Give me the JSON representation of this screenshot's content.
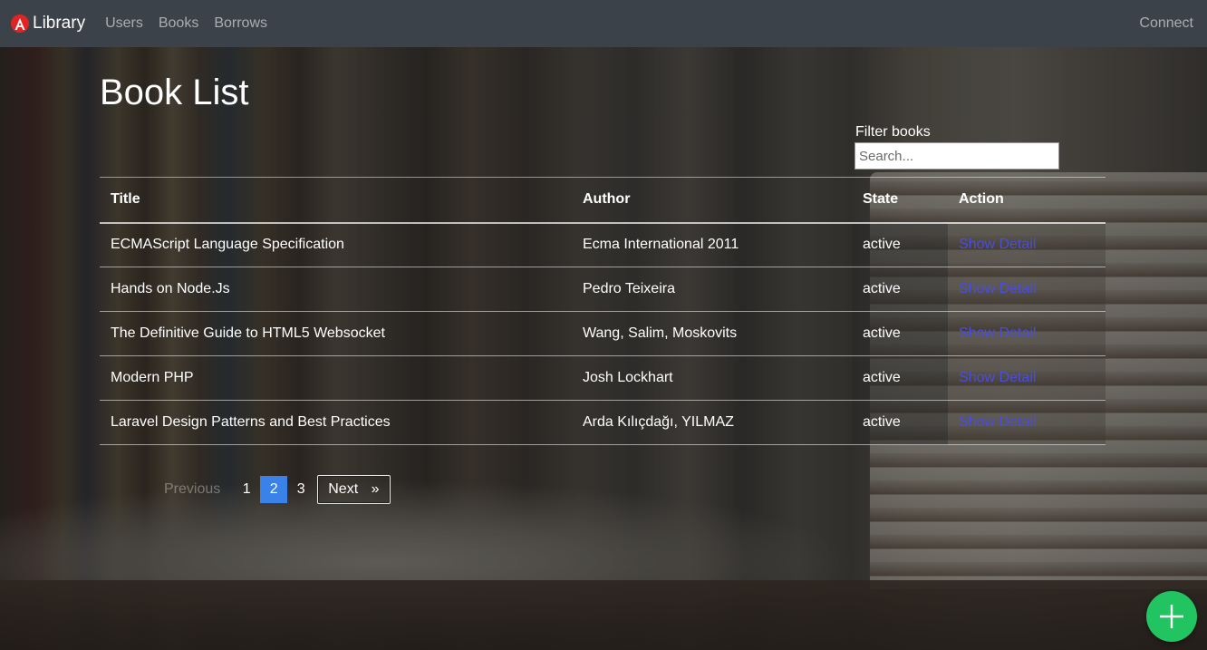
{
  "navbar": {
    "brand": "Library",
    "brand_icon": "angular-logo-icon",
    "links": [
      "Users",
      "Books",
      "Borrows"
    ],
    "connect": "Connect"
  },
  "page": {
    "title": "Book List"
  },
  "filter": {
    "label": "Filter books",
    "placeholder": "Search...",
    "value": ""
  },
  "table": {
    "headers": [
      "Title",
      "Author",
      "State",
      "Action"
    ],
    "rows": [
      {
        "title": "ECMAScript Language Specification",
        "author": "Ecma International 2011",
        "state": "active",
        "action": "Show Detail"
      },
      {
        "title": "Hands on Node.Js",
        "author": "Pedro Teixeira",
        "state": "active",
        "action": "Show Detail"
      },
      {
        "title": "The Definitive Guide to HTML5 Websocket",
        "author": "Wang, Salim, Moskovits",
        "state": "active",
        "action": "Show Detail"
      },
      {
        "title": "Modern PHP",
        "author": "Josh Lockhart",
        "state": "active",
        "action": "Show Detail"
      },
      {
        "title": "Laravel Design Patterns and Best Practices",
        "author": "Arda Kılıçdağı, YILMAZ",
        "state": "active",
        "action": "Show Detail"
      }
    ]
  },
  "pagination": {
    "previous": "Previous",
    "pages": [
      "1",
      "2",
      "3"
    ],
    "current_page": "2",
    "next": "Next",
    "next_arrow": "»"
  },
  "fab": {
    "icon": "plus-icon"
  },
  "colors": {
    "navbar_bg": "#3c4249",
    "link": "#4a4de0",
    "current_page": "#3b82e8",
    "fab": "#21c460",
    "brand_red": "#e02424"
  }
}
